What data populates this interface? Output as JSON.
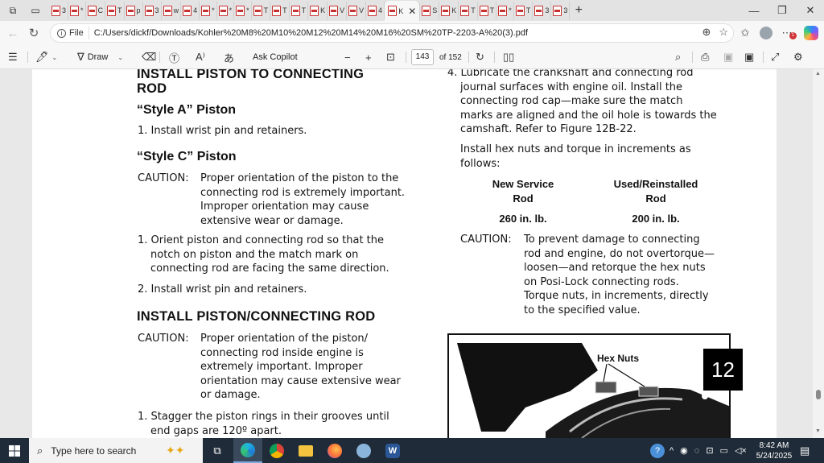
{
  "browser": {
    "active_tab_title": "K",
    "tab_letters": [
      "3",
      "*",
      "C",
      "T",
      "p",
      "3",
      "w",
      "4",
      "*",
      "*",
      "*",
      "T",
      "T",
      "T",
      "K",
      "V",
      "V",
      "4",
      "S",
      "K",
      "T",
      "T",
      "*",
      "T",
      "3",
      "3"
    ],
    "new_tab_label": "+",
    "address_label": "File",
    "url": "C:/Users/dickf/Downloads/Kohler%20M8%20M10%20M12%20M14%20M16%20SM%20TP-2203-A%20(3).pdf",
    "notification_count": "1"
  },
  "pdf_toolbar": {
    "draw_label": "Draw",
    "ask_copilot_label": "Ask Copilot",
    "page_current": "143",
    "page_total": "of 152"
  },
  "document": {
    "left": {
      "heading1": "INSTALL PISTON TO CONNECTING",
      "heading1_cont": "ROD",
      "style_a": "“Style A” Piston",
      "style_a_step1": "1. Install wrist pin and retainers.",
      "style_c": "“Style C” Piston",
      "caution_label": "CAUTION:",
      "caution1": [
        "Proper orientation of the piston to the",
        "connecting rod is extremely important.",
        "Improper orientation may cause",
        "extensive wear or damage."
      ],
      "step1": [
        "1. Orient piston and connecting rod so that the",
        "notch on piston and the match mark on",
        "connecting rod are facing the same direction."
      ],
      "step2": "2. Install wrist pin and retainers.",
      "heading2": "INSTALL PISTON/CONNECTING ROD",
      "caution2": [
        "Proper orientation of the piston/",
        "connecting rod inside engine is",
        "extremely important. Improper",
        "orientation may cause extensive wear",
        "or damage."
      ],
      "stagger": [
        "1. Stagger the piston rings in their grooves until",
        "end gaps are 120º apart."
      ]
    },
    "right": {
      "step4": [
        "4. Lubricate the crankshaft and connecting rod",
        "journal surfaces with engine oil. Install the",
        "connecting rod cap—make sure the match",
        "marks are aligned and the oil hole is towards the",
        "camshaft. Refer to Figure 12B-22."
      ],
      "torque_intro": [
        "Install hex nuts and torque in increments as",
        "follows:"
      ],
      "table": {
        "col1_header": [
          "New Service",
          "Rod"
        ],
        "col2_header": [
          "Used/Reinstalled",
          "Rod"
        ],
        "col1_value": "260 in. lb.",
        "col2_value": "200 in. lb."
      },
      "caution_label": "CAUTION:",
      "caution": [
        "To prevent damage to connecting",
        "rod and engine, do not overtorque—",
        "loosen—and retorque the hex nuts",
        "on Posi-Lock connecting rods.",
        "Torque nuts, in increments, directly",
        "to the specified value."
      ],
      "figure_label": "Hex Nuts",
      "section_number": "12"
    }
  },
  "taskbar": {
    "search_placeholder": "Type here to search",
    "time": "8:42 AM",
    "date": "5/24/2025"
  }
}
